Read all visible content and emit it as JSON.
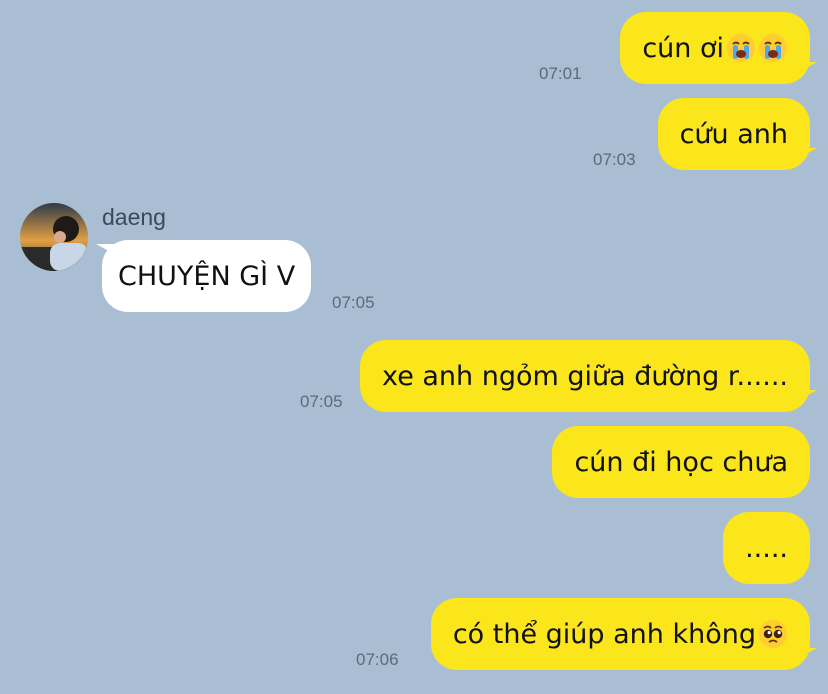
{
  "chat": {
    "contact_name": "daeng",
    "messages": [
      {
        "side": "out",
        "text": "cún ơi",
        "emoji": [
          "loudly-crying-face-icon",
          "loudly-crying-face-icon"
        ],
        "time": "07:01"
      },
      {
        "side": "out",
        "text": "cứu anh",
        "time": "07:03"
      },
      {
        "side": "in",
        "sender": "daeng",
        "text": "CHUYỆN GÌ V",
        "time": "07:05"
      },
      {
        "side": "out",
        "text": "xe anh ngỏm giữa đường r......",
        "time": "07:05"
      },
      {
        "side": "out",
        "text": "cún đi học chưa",
        "time": ""
      },
      {
        "side": "out",
        "text": ".....",
        "time": ""
      },
      {
        "side": "out",
        "text": "có thể giúp anh không",
        "emoji": [
          "pleading-face-icon"
        ],
        "time": "07:06"
      }
    ]
  },
  "colors": {
    "background": "#a9bed2",
    "outgoing_bubble": "#fbe51b",
    "incoming_bubble": "#ffffff",
    "timestamp": "#5b6b7a"
  }
}
